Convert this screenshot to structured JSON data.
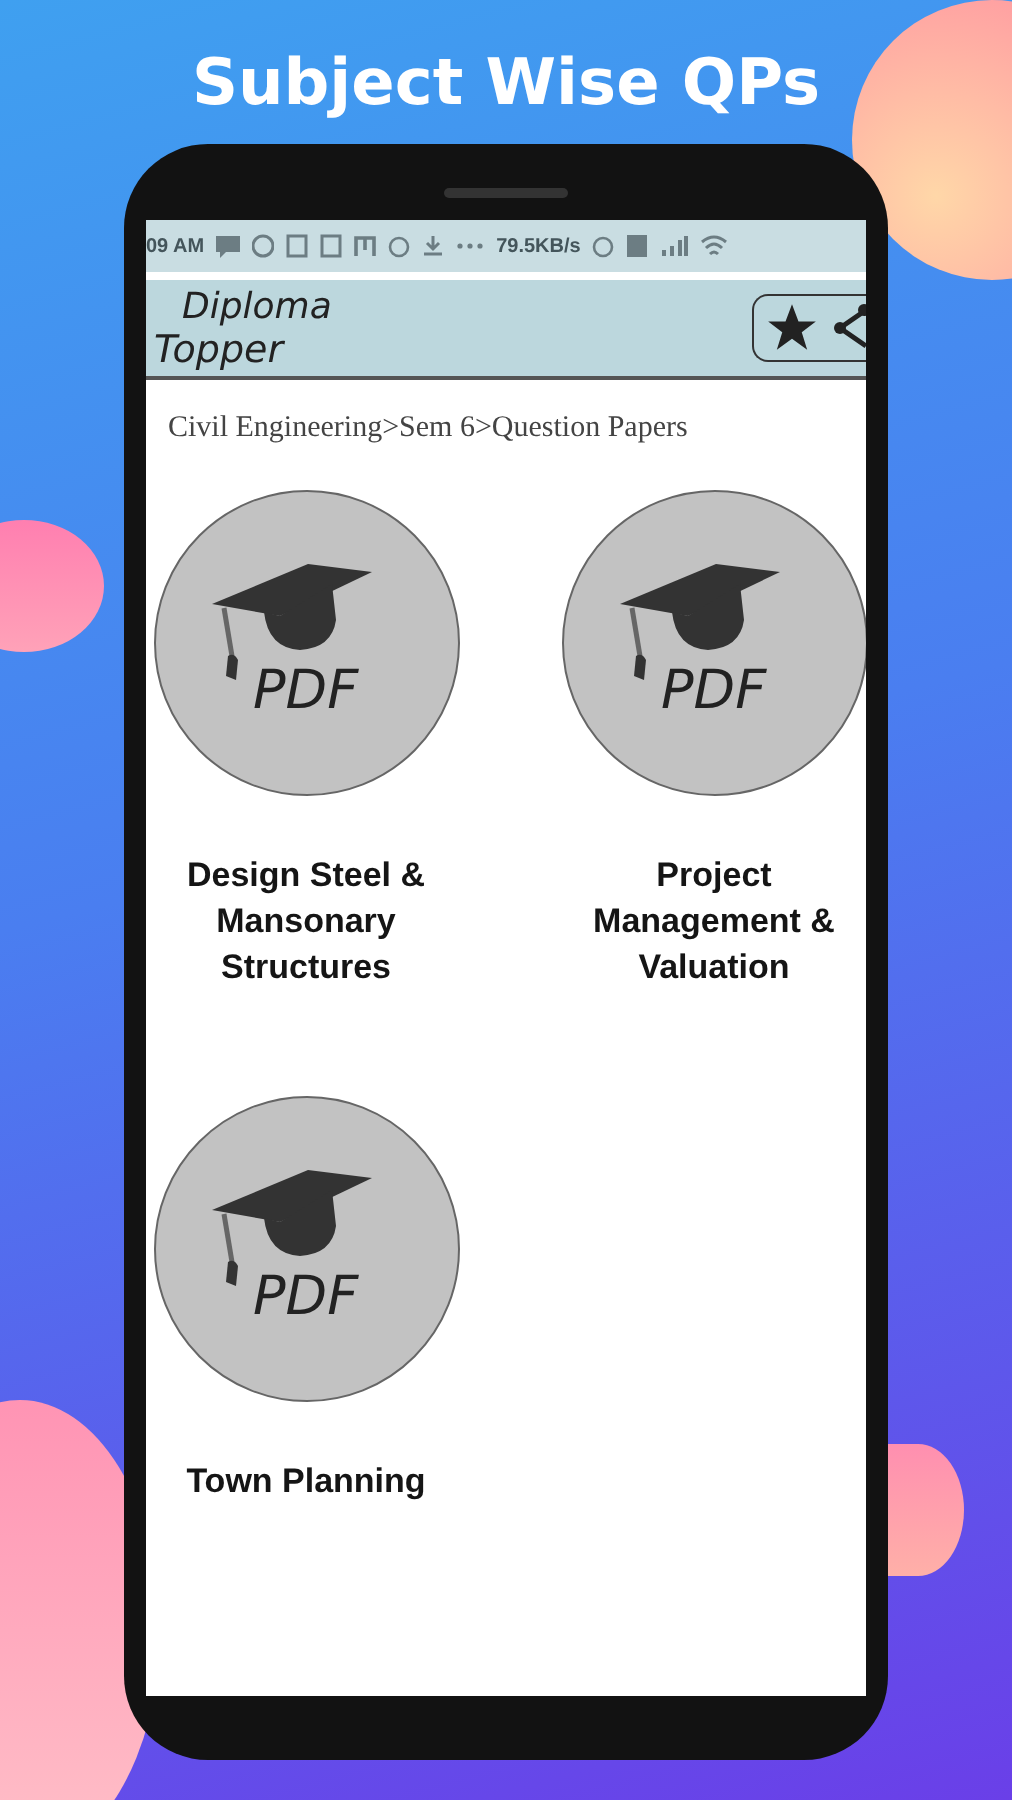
{
  "promo_title": "Subject Wise QPs",
  "status_bar": {
    "time": "09 AM",
    "speed": "79.5KB/s"
  },
  "app_bar": {
    "logo_top": "Diploma",
    "logo_bottom": "Topper"
  },
  "breadcrumb": "Civil Engineering>Sem 6>Question Papers",
  "subjects": [
    {
      "name": "Design Steel & Mansonary Structures",
      "badge": "PDF"
    },
    {
      "name": "Project Management & Valuation",
      "badge": "PDF"
    },
    {
      "name": "Town Planning",
      "badge": "PDF"
    }
  ]
}
